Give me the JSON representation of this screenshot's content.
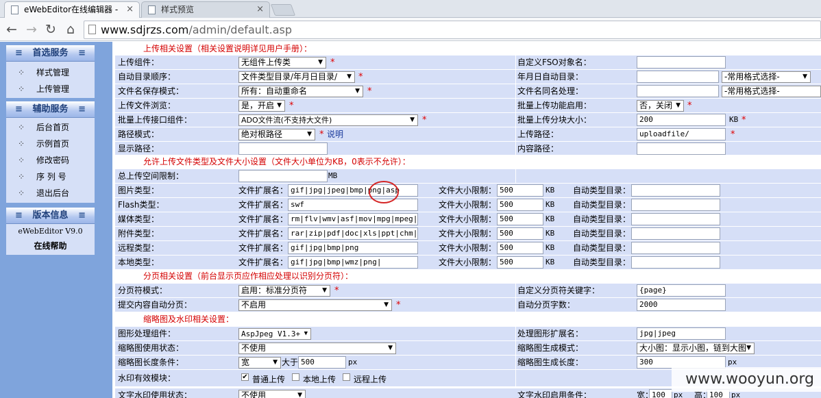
{
  "browser": {
    "tabs": [
      {
        "title": "eWebEditor在线编辑器 -",
        "close": "×"
      },
      {
        "title": "样式预览",
        "close": "×"
      }
    ],
    "url_host": "www.sdjrzs.com",
    "url_path": "/admin/default.asp"
  },
  "sidebar": {
    "sections": [
      {
        "title": "首选服务",
        "items": [
          "样式管理",
          "上传管理"
        ]
      },
      {
        "title": "辅助服务",
        "items": [
          "后台首页",
          "示例首页",
          "修改密码",
          "序 列 号",
          "退出后台"
        ]
      },
      {
        "title": "版本信息",
        "version": "eWebEditor V9.0",
        "help": "在线帮助"
      }
    ]
  },
  "upload": {
    "title": "上传相关设置（相关设置说明详见用户手册）：",
    "component_label": "上传组件：",
    "component_value": "无组件上传类",
    "fso_label": "自定义FSO对象名：",
    "autodir_label": "自动目录顺序：",
    "autodir_value": "文件类型目录/年月日目录/",
    "ymd_label": "年月日自动目录：",
    "format_select": "-常用格式选择-",
    "save_mode_label": "文件名保存模式：",
    "save_mode_value": "所有：自动重命名",
    "same_name_label": "文件名同名处理：",
    "same_name_select": "-常用格式选择-",
    "browse_label": "上传文件浏览：",
    "browse_value": "是，开启",
    "batch_enable_label": "批量上传功能启用：",
    "batch_enable_value": "否，关闭",
    "batch_comp_label": "批量上传接口组件：",
    "batch_comp_value": "ADO文件流(不支持大文件)",
    "batch_size_label": "批量上传分块大小：",
    "batch_size_value": "200",
    "kb": "KB",
    "path_mode_label": "路径模式：",
    "path_mode_value": "绝对根路径",
    "explain": "说明",
    "upload_path_label": "上传路径：",
    "upload_path_value": "uploadfile/",
    "display_path_label": "显示路径：",
    "content_path_label": "内容路径："
  },
  "types": {
    "title": "允许上传文件类型及文件大小设置（文件大小单位为KB，0表示不允许）：",
    "total_label": "总上传空间限制：",
    "total_unit": "MB",
    "ext_label": "文件扩展名：",
    "size_label": "文件大小限制：",
    "autodir_label": "自动类型目录：",
    "kb": "KB",
    "rows": [
      {
        "label": "图片类型：",
        "ext": "gif|jpg|jpeg|bmp|png|asp",
        "size": "500"
      },
      {
        "label": "Flash类型：",
        "ext": "swf",
        "size": "500"
      },
      {
        "label": "媒体类型：",
        "ext": "rm|flv|wmv|asf|mov|mpg|mpeg|avi",
        "size": "500"
      },
      {
        "label": "附件类型：",
        "ext": "rar|zip|pdf|doc|xls|ppt|chm|hlp",
        "size": "500"
      },
      {
        "label": "远程类型：",
        "ext": "gif|jpg|bmp|png",
        "size": "500"
      },
      {
        "label": "本地类型：",
        "ext": "gif|jpg|bmp|wmz|png|",
        "size": "500"
      }
    ]
  },
  "paging": {
    "title": "分页相关设置（前台显示页应作相应处理以识别分页符）：",
    "mode_label": "分页符模式：",
    "mode_value": "启用：标准分页符",
    "keyword_label": "自定义分页符关键字：",
    "keyword_value": "{page}",
    "auto_label": "提交内容自动分页：",
    "auto_value": "不启用",
    "count_label": "自动分页字数：",
    "count_value": "2000"
  },
  "thumb": {
    "title": "缩略图及水印相关设置：",
    "comp_label": "图形处理组件：",
    "comp_value": "AspJpeg V1.3+",
    "ext_label": "处理图形扩展名：",
    "ext_value": "jpg|jpeg",
    "state_label": "缩略图使用状态：",
    "state_value": "不使用",
    "gen_label": "缩略图生成模式：",
    "gen_value": "大小图：显示小图，链到大图",
    "len_cond_label": "缩略图长度条件：",
    "len_cond_value": "宽",
    "gt_label": "大于",
    "gt_value": "500",
    "px": "px",
    "len_label": "缩略图生成长度：",
    "len_value": "300",
    "wm_label": "水印有效模块：",
    "wm_opts": [
      "普通上传",
      "本地上传",
      "远程上传"
    ],
    "wm_text_label": "文字水印使用状态：",
    "wm_text_value": "不使用",
    "wm_cond_label": "文字水印启用条件：",
    "w_label": "宽：",
    "w_value": "100",
    "h_label": "高：",
    "h_value": "100"
  },
  "watermark": "www.wooyun.org"
}
